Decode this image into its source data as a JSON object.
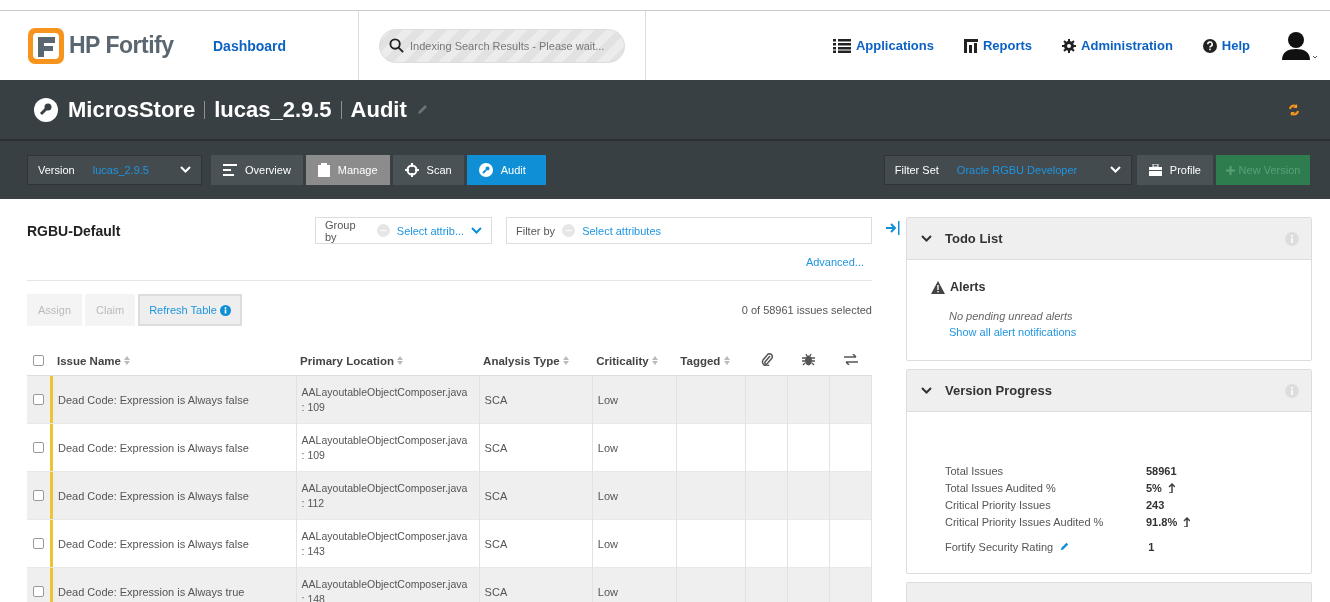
{
  "header": {
    "brand": "HP Fortify",
    "dashboard": "Dashboard",
    "search": {
      "placeholder": "Indexing Search Results - Please wait..."
    },
    "nav": [
      {
        "kind": "list",
        "label": "Applications"
      },
      {
        "kind": "reports",
        "label": "Reports"
      },
      {
        "kind": "gear",
        "label": "Administration"
      },
      {
        "kind": "help",
        "label": "Help"
      }
    ]
  },
  "title_bar": {
    "application": "MicrosStore",
    "version": "lucas_2.9.5",
    "page": "Audit"
  },
  "toolbar": {
    "version_label": "Version",
    "version_value": "lucas_2.9.5",
    "tabs": [
      {
        "kind": "overview",
        "label": "Overview",
        "selected": false
      },
      {
        "kind": "manage",
        "label": "Manage",
        "selected": false
      },
      {
        "kind": "scan",
        "label": "Scan",
        "selected": false
      },
      {
        "kind": "audit",
        "label": "Audit",
        "selected": true
      }
    ],
    "filter_set_label": "Filter Set",
    "filter_set_value": "Oracle RGBU Developer",
    "profile": "Profile",
    "new_version": {
      "label": "New Version",
      "disabled": true
    }
  },
  "issues": {
    "title": "RGBU-Default",
    "group_by": {
      "label": "Group by",
      "placeholder": "Select attrib..."
    },
    "filter_by": {
      "label": "Filter by",
      "placeholder": "Select attributes"
    },
    "advanced": "Advanced...",
    "actions": [
      {
        "label": "Assign",
        "disabled": true
      },
      {
        "label": "Claim",
        "disabled": true
      },
      {
        "label": "Refresh Table",
        "disabled": false
      }
    ],
    "selection_count": "0 of 58961 issues selected",
    "select_all_checked": false,
    "columns": [
      "Issue Name",
      "Primary Location",
      "Analysis Type",
      "Criticality",
      "Tagged"
    ],
    "rows": [
      {
        "checked": false,
        "color": "#f0c330",
        "issue_name": "Dead Code: Expression is Always false",
        "file": "AALayoutableObjectComposer.java",
        "line": ": 109",
        "analysis_type": "SCA",
        "criticality": "Low"
      },
      {
        "checked": false,
        "color": "#f0c330",
        "issue_name": "Dead Code: Expression is Always false",
        "file": "AALayoutableObjectComposer.java",
        "line": ": 109",
        "analysis_type": "SCA",
        "criticality": "Low"
      },
      {
        "checked": false,
        "color": "#f0c330",
        "issue_name": "Dead Code: Expression is Always false",
        "file": "AALayoutableObjectComposer.java",
        "line": ": 112",
        "analysis_type": "SCA",
        "criticality": "Low"
      },
      {
        "checked": false,
        "color": "#f0c330",
        "issue_name": "Dead Code: Expression is Always false",
        "file": "AALayoutableObjectComposer.java",
        "line": ": 143",
        "analysis_type": "SCA",
        "criticality": "Low"
      },
      {
        "checked": false,
        "color": "#f0c330",
        "issue_name": "Dead Code: Expression is Always true",
        "file": "AALayoutableObjectComposer.java",
        "line": ": 148",
        "analysis_type": "SCA",
        "criticality": "Low"
      }
    ]
  },
  "todo_list": {
    "title": "Todo List",
    "expanded": true,
    "alerts_title": "Alerts",
    "empty_message": "No pending unread alerts",
    "link": "Show all alert notifications"
  },
  "version_progress": {
    "title": "Version Progress",
    "expanded": true,
    "stats": [
      {
        "label": "Total Issues",
        "value": "58961",
        "trend_up": false,
        "editable": false
      },
      {
        "label": "Total Issues Audited %",
        "value": "5%",
        "trend_up": true,
        "editable": false
      },
      {
        "label": "Critical Priority Issues",
        "value": "243",
        "trend_up": false,
        "editable": false
      },
      {
        "label": "Critical Priority Issues Audited %",
        "value": "91.8%",
        "trend_up": true,
        "editable": false
      },
      {
        "label": "Fortify Security Rating",
        "value": "1",
        "trend_up": false,
        "editable": true
      }
    ]
  }
}
